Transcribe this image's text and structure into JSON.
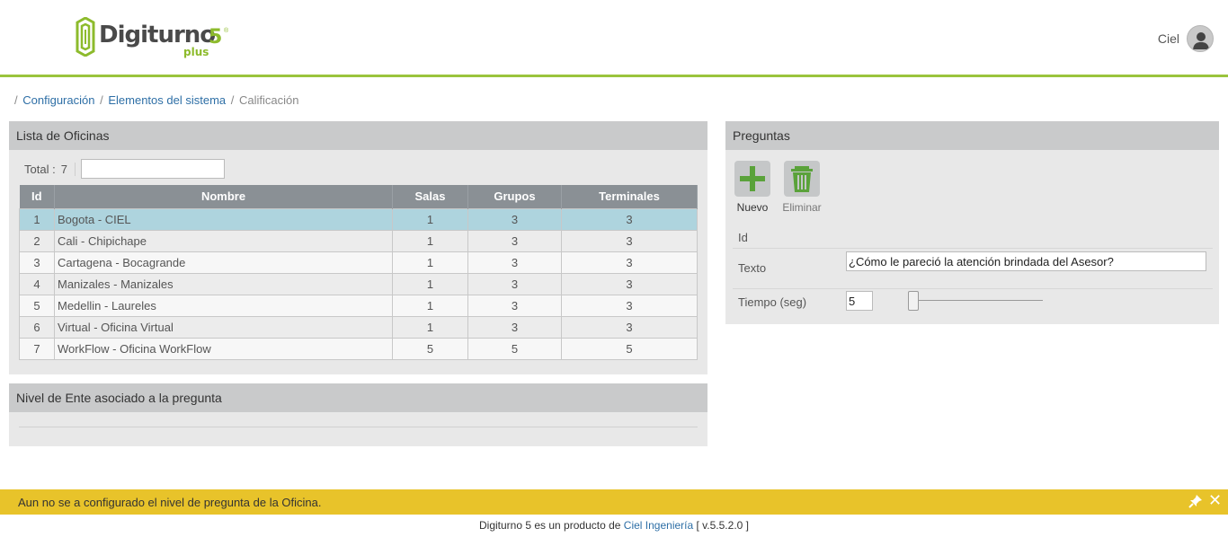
{
  "header": {
    "logo_word": "Digiturno",
    "logo_number": "5",
    "logo_reg": "®",
    "logo_sub": "plus",
    "user_name": "Ciel",
    "accent_color": "#9ac43c"
  },
  "breadcrumb": {
    "items": [
      "Configuración",
      "Elementos del sistema"
    ],
    "current": "Calificación",
    "separator": "/"
  },
  "offices_panel": {
    "title": "Lista de Oficinas",
    "total_label": "Total :",
    "total_count": "7",
    "filter_value": "",
    "columns": [
      "Id",
      "Nombre",
      "Salas",
      "Grupos",
      "Terminales"
    ],
    "rows": [
      {
        "id": "1",
        "name": "Bogota - CIEL",
        "salas": "1",
        "grupos": "3",
        "terminales": "3",
        "selected": true
      },
      {
        "id": "2",
        "name": "Cali - Chipichape",
        "salas": "1",
        "grupos": "3",
        "terminales": "3"
      },
      {
        "id": "3",
        "name": "Cartagena - Bocagrande",
        "salas": "1",
        "grupos": "3",
        "terminales": "3"
      },
      {
        "id": "4",
        "name": "Manizales - Manizales",
        "salas": "1",
        "grupos": "3",
        "terminales": "3"
      },
      {
        "id": "5",
        "name": "Medellin - Laureles",
        "salas": "1",
        "grupos": "3",
        "terminales": "3"
      },
      {
        "id": "6",
        "name": "Virtual - Oficina Virtual",
        "salas": "1",
        "grupos": "3",
        "terminales": "3"
      },
      {
        "id": "7",
        "name": "WorkFlow - Oficina WorkFlow",
        "salas": "5",
        "grupos": "5",
        "terminales": "5"
      }
    ]
  },
  "level_panel": {
    "title": "Nivel de Ente asociado a la pregunta"
  },
  "questions_panel": {
    "title": "Preguntas",
    "new_label": "Nuevo",
    "delete_label": "Eliminar",
    "id_label": "Id",
    "text_label": "Texto",
    "text_value": "¿Cómo le pareció la atención brindada del Asesor?",
    "time_label": "Tiempo (seg)",
    "time_value": "5",
    "time_slider_fraction": 0.0
  },
  "notice": {
    "text": "Aun no se a configurado el nivel de pregunta de la Oficina.",
    "color": "#e8c32a"
  },
  "footer": {
    "prefix": "Digiturno 5 es un producto de",
    "company": "Ciel Ingeniería",
    "version": "[ v.5.5.2.0 ]"
  }
}
